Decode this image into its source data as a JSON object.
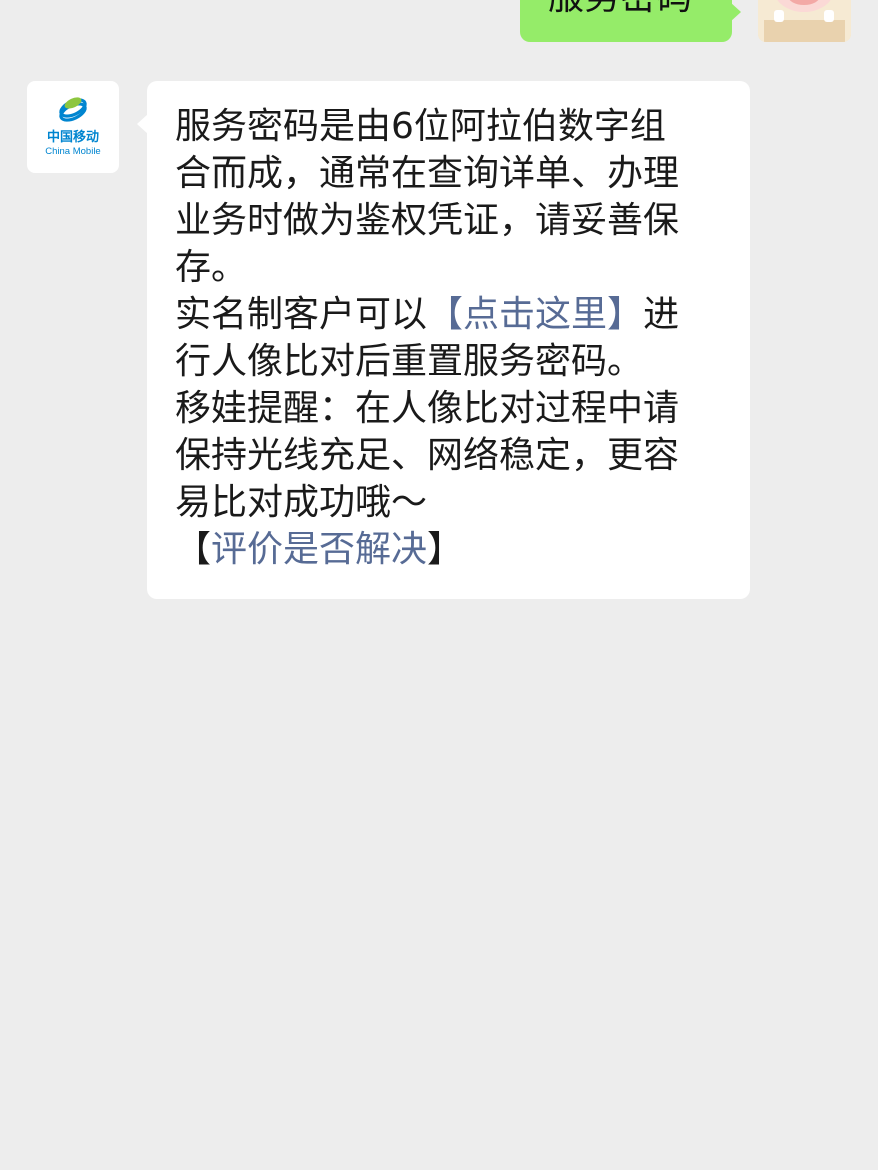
{
  "colors": {
    "background": "#ededed",
    "outgoing_bubble": "#95ec69",
    "incoming_bubble": "#ffffff",
    "link": "#576b95",
    "brand": "#0085d0"
  },
  "outgoing": {
    "text": "服务密码"
  },
  "incoming": {
    "sender_logo": {
      "icon": "china-mobile-logo-icon",
      "cn": "中国移动",
      "en": "China Mobile"
    },
    "lines": [
      "服务密码是由6位阿拉伯数字组",
      "合而成，通常在查询详单、办理",
      "业务时做为鉴权凭证，请妥善保",
      "存。"
    ],
    "reset": {
      "prefix": "实名制客户可以",
      "link_open": "【",
      "link_text": "点击这里",
      "link_close": "】",
      "suffix": "进",
      "line2": "行人像比对后重置服务密码。"
    },
    "tip_lines": [
      "移娃提醒：在人像比对过程中请",
      "保持光线充足、网络稳定，更容",
      "易比对成功哦～"
    ],
    "feedback": {
      "open": "【",
      "link_text": "评价是否解决",
      "close": "】"
    }
  }
}
